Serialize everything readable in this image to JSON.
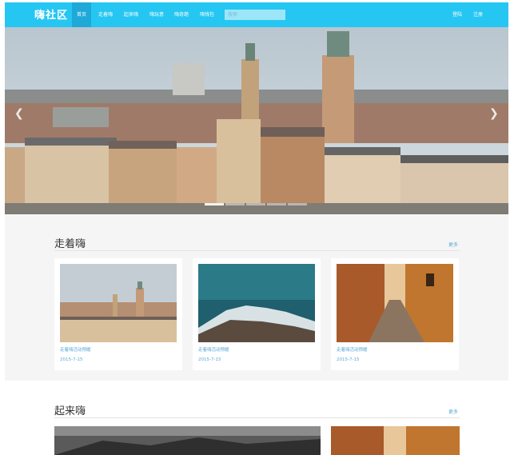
{
  "nav": {
    "brand": "嗨社区",
    "items": [
      {
        "label": "首页",
        "active": true
      },
      {
        "label": "走着嗨",
        "active": false
      },
      {
        "label": "起来嗨",
        "active": false
      },
      {
        "label": "嗨玩意",
        "active": false
      },
      {
        "label": "嗨奇葩",
        "active": false
      },
      {
        "label": "嗨钱包",
        "active": false
      }
    ],
    "search_placeholder": "搜索",
    "login": "登陆",
    "register": "注册"
  },
  "hero": {
    "prev_icon": "chevron-left-icon",
    "next_icon": "chevron-right-icon",
    "slide_count": 5,
    "active_slide": 1
  },
  "sections": [
    {
      "title": "走着嗨",
      "more": "更多",
      "cards": [
        {
          "title": "走着嗨活动预暖",
          "date": "2015-7-15"
        },
        {
          "title": "走着嗨活动预暖",
          "date": "2015-7-15"
        },
        {
          "title": "走着嗨活动预暖",
          "date": "2015-7-15"
        }
      ]
    },
    {
      "title": "起来嗨",
      "more": "更多"
    }
  ],
  "colors": {
    "accent": "#26c6f2",
    "accent_active": "#1ea9d8",
    "link": "#5aa9d6"
  }
}
